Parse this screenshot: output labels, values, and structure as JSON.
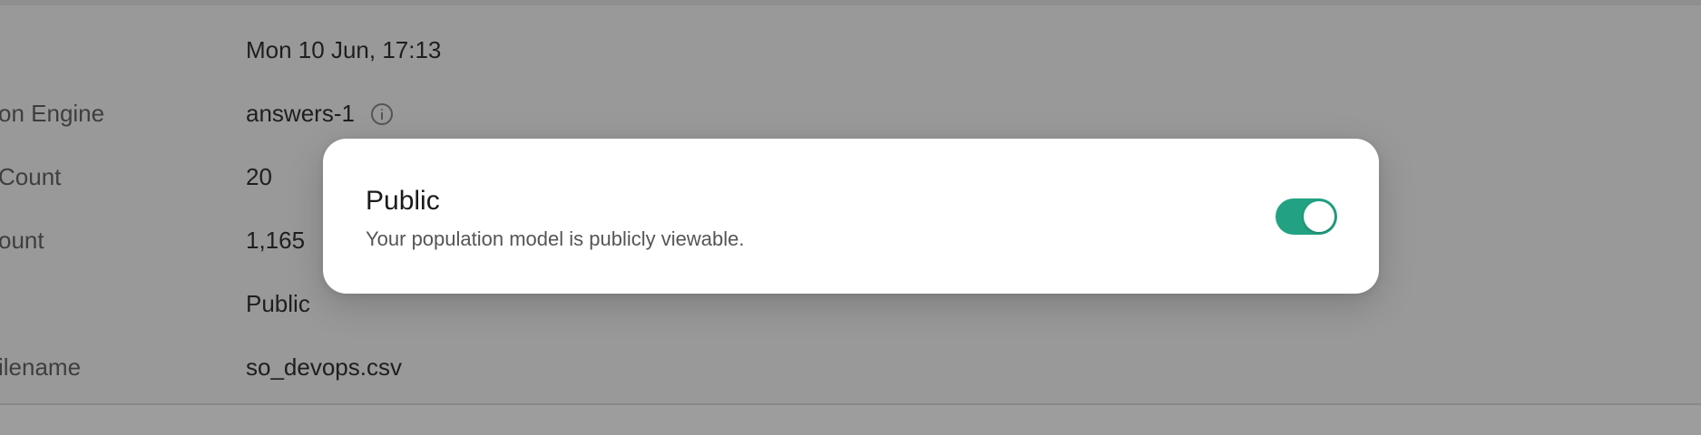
{
  "details": {
    "rows": [
      {
        "label": "",
        "value": "Mon 10 Jun, 17:13"
      },
      {
        "label": "on Engine",
        "value": "answers-1",
        "icon": "info-icon"
      },
      {
        "label": " Count",
        "value": "20"
      },
      {
        "label": "ount",
        "value": "1,165"
      },
      {
        "label": "",
        "value": "Public"
      },
      {
        "label": "ilename",
        "value": "so_devops.csv"
      }
    ]
  },
  "modal": {
    "title": "Public",
    "subtitle": "Your population model is publicly viewable.",
    "toggle": {
      "on": true,
      "color": "#22a283"
    }
  }
}
